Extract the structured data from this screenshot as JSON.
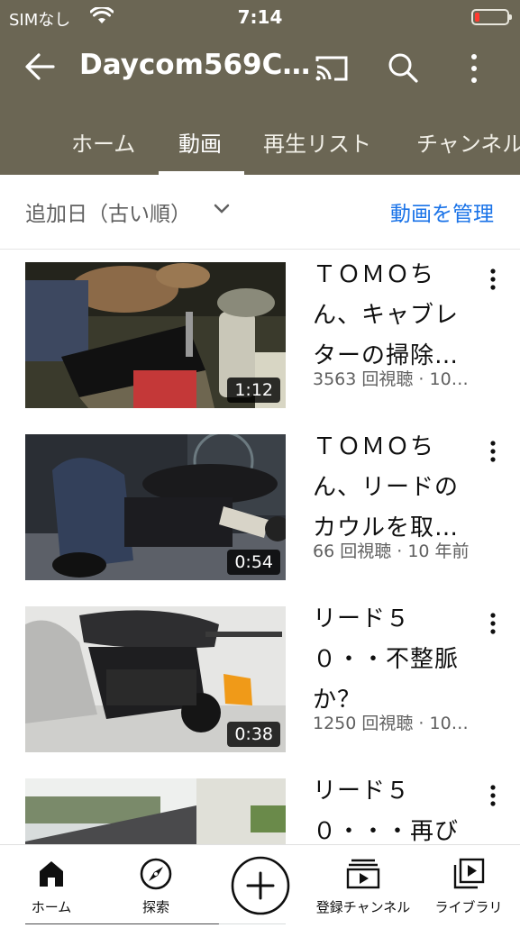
{
  "status": {
    "carrier": "SIMなし",
    "time": "7:14",
    "battery_color": "#ff3b30"
  },
  "appbar": {
    "title": "Daycom569C…",
    "bg": "#6b6654"
  },
  "tabs": [
    {
      "label": "ホーム",
      "active": false
    },
    {
      "label": "動画",
      "active": true
    },
    {
      "label": "再生リスト",
      "active": false
    },
    {
      "label": "チャンネル",
      "active": false
    }
  ],
  "sort": {
    "label": "追加日（古い順）",
    "manage_label": "動画を管理",
    "accent": "#1a73e8"
  },
  "videos": [
    {
      "title_lines": [
        "ＴＯＭＯち",
        "ん、キャブレ",
        "ターの掃除…"
      ],
      "meta": "3563 回視聴 · 10…",
      "duration": "1:12"
    },
    {
      "title_lines": [
        "ＴＯＭＯち",
        "ん、リードの",
        "カウルを取…"
      ],
      "meta": "66 回視聴 · 10 年前",
      "duration": "0:54"
    },
    {
      "title_lines": [
        "リード５",
        "０・・不整脈",
        "か？"
      ],
      "meta": "1250 回視聴 · 10…",
      "duration": "0:38"
    },
    {
      "title_lines": [
        "リード５",
        "０・・・再び"
      ],
      "meta": "",
      "duration": ""
    }
  ],
  "bottom_nav": [
    {
      "label": "ホーム",
      "icon": "home-icon"
    },
    {
      "label": "探索",
      "icon": "explore-icon"
    },
    {
      "label": "",
      "icon": "create-icon"
    },
    {
      "label": "登録チャンネル",
      "icon": "subscriptions-icon"
    },
    {
      "label": "ライブラリ",
      "icon": "library-icon"
    }
  ]
}
